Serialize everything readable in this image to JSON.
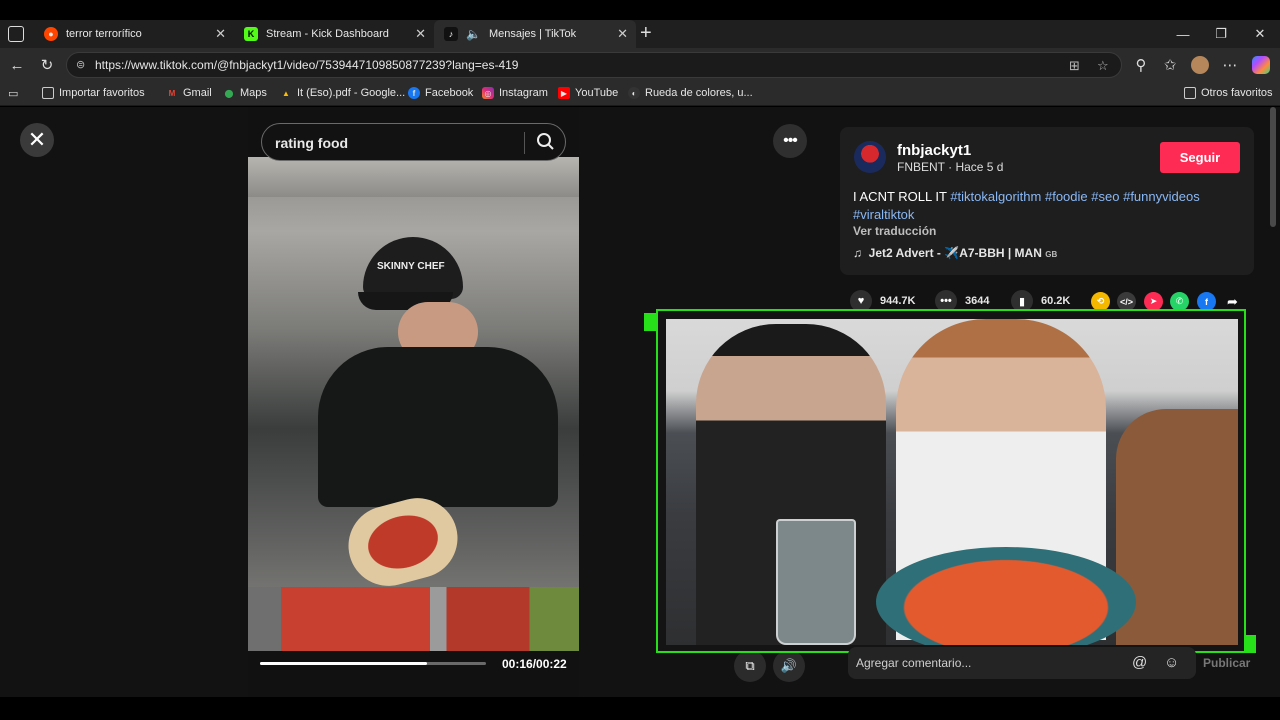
{
  "tabs": [
    {
      "title": "terror terrorífico",
      "icon": "reddit-icon",
      "color": "#ff4500"
    },
    {
      "title": "Stream - Kick Dashboard",
      "icon": "kick-icon",
      "color": "#53fc18"
    },
    {
      "title": "Mensajes | TikTok",
      "icon": "tiktok-icon",
      "color": "#000000",
      "active": true
    }
  ],
  "address": {
    "url": "https://www.tiktok.com/@fnbjackyt1/video/7539447109850877239?lang=es-419"
  },
  "bookmarks": {
    "import": "Importar favoritos",
    "items": [
      "Gmail",
      "Maps",
      "It (Eso).pdf - Google...",
      "Facebook",
      "Instagram",
      "YouTube",
      "Rueda de colores, u..."
    ],
    "other": "Otros favoritos"
  },
  "video": {
    "search_query": "rating food",
    "time": "00:16/00:22",
    "progress": 0.74,
    "overlay_text": "SKINNY CHEF"
  },
  "post": {
    "username": "fnbjackyt1",
    "meta": "FNBENT · Hace 5 d",
    "follow_label": "Seguir",
    "desc_text": "I ACNT ROLL IT",
    "hashtags": [
      "#tiktokalgorithm",
      "#foodie",
      "#seo",
      "#funnyvideos",
      "#viraltiktok"
    ],
    "translate_label": "Ver traducción",
    "music": "Jet2 Advert - ✈️A7-BBH | MAN",
    "music_suffix": "GB"
  },
  "stats": {
    "likes": "944.7K",
    "comments": "3644",
    "saves": "60.2K"
  },
  "comment": {
    "placeholder": "Agregar comentario...",
    "publish_label": "Publicar"
  },
  "colors": {
    "accent": "#fe2c55",
    "hashtag": "#8ab8f5",
    "webcam_border": "#27e01a"
  }
}
